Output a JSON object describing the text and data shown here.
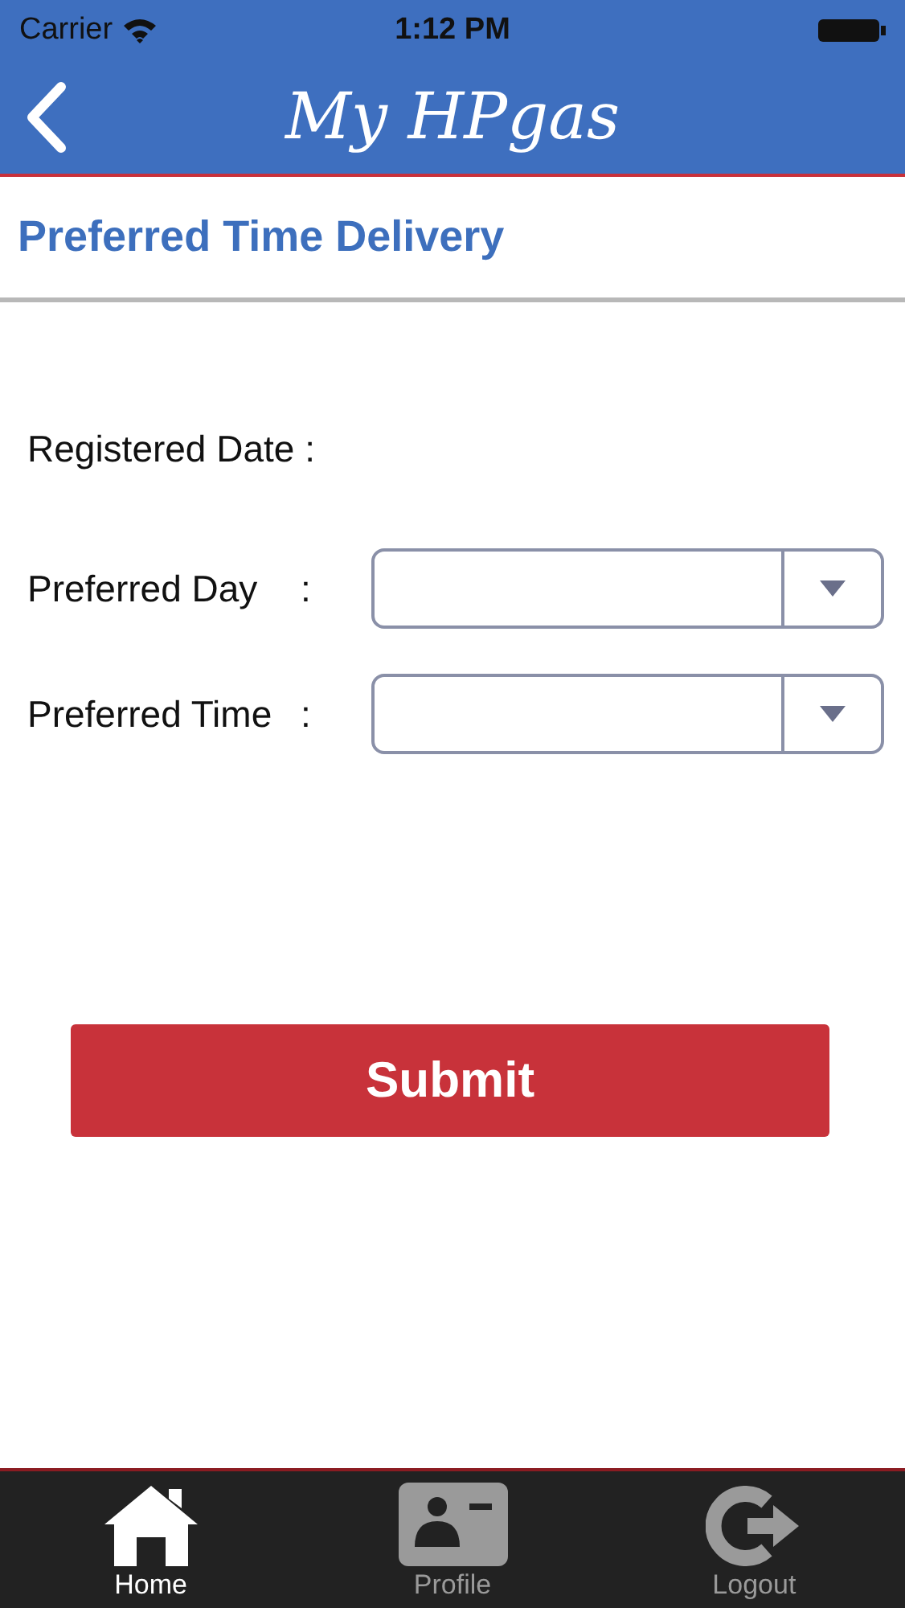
{
  "status_bar": {
    "carrier": "Carrier",
    "time": "1:12 PM"
  },
  "nav": {
    "title": "My HPgas"
  },
  "section_title": "Preferred Time Delivery",
  "registered_date": {
    "label": "Registered Date :"
  },
  "fields": [
    {
      "label": "Preferred Day",
      "colon": ":"
    },
    {
      "label": "Preferred Time",
      "colon": ":"
    }
  ],
  "submit": "Submit",
  "tabs": [
    {
      "label": "Home",
      "kind": "home",
      "selected": true
    },
    {
      "label": "Profile",
      "kind": "profile",
      "selected": false
    },
    {
      "label": "Logout",
      "kind": "logout",
      "selected": false
    }
  ]
}
